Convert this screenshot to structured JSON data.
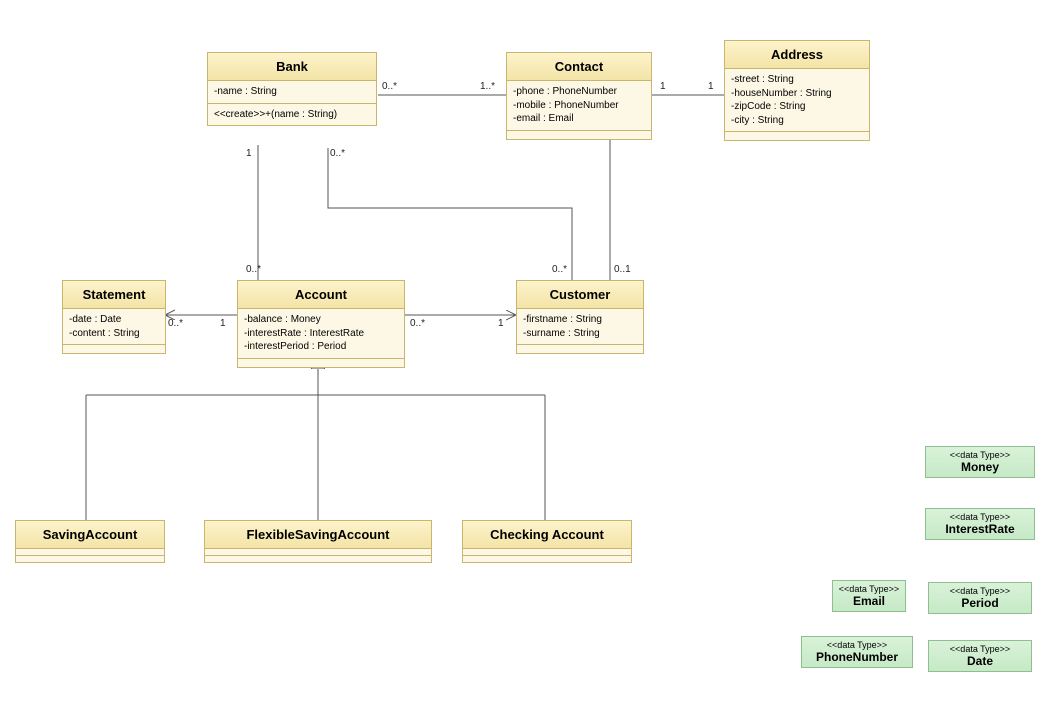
{
  "classes": {
    "bank": {
      "name": "Bank",
      "attrs": [
        "-name : String"
      ],
      "ops": [
        "<<create>>+(name : String)"
      ]
    },
    "contact": {
      "name": "Contact",
      "attrs": [
        "-phone : PhoneNumber",
        "-mobile : PhoneNumber",
        "-email : Email"
      ],
      "ops": []
    },
    "address": {
      "name": "Address",
      "attrs": [
        "-street : String",
        "-houseNumber : String",
        "-zipCode : String",
        "-city : String"
      ],
      "ops": []
    },
    "statement": {
      "name": "Statement",
      "attrs": [
        "-date : Date",
        "-content : String"
      ],
      "ops": []
    },
    "account": {
      "name": "Account",
      "attrs": [
        "-balance : Money",
        "-interestRate : InterestRate",
        "-interestPeriod : Period"
      ],
      "ops": []
    },
    "customer": {
      "name": "Customer",
      "attrs": [
        "-firstname : String",
        "-surname : String"
      ],
      "ops": []
    },
    "saving": {
      "name": "SavingAccount",
      "attrs": [],
      "ops": []
    },
    "flexible": {
      "name": "FlexibleSavingAccount",
      "attrs": [],
      "ops": []
    },
    "checking": {
      "name": "Checking Account",
      "attrs": [],
      "ops": []
    }
  },
  "datatypes": {
    "money": {
      "stereo": "<<data Type>>",
      "name": "Money"
    },
    "interestrate": {
      "stereo": "<<data Type>>",
      "name": "InterestRate"
    },
    "period": {
      "stereo": "<<data Type>>",
      "name": "Period"
    },
    "email": {
      "stereo": "<<data Type>>",
      "name": "Email"
    },
    "phonenumber": {
      "stereo": "<<data Type>>",
      "name": "PhoneNumber"
    },
    "date": {
      "stereo": "<<data Type>>",
      "name": "Date"
    }
  },
  "associations": {
    "bank_contact": {
      "m1": "0..*",
      "m2": "1..*"
    },
    "contact_address": {
      "m1": "1",
      "m2": "1"
    },
    "bank_account": {
      "m1": "1",
      "m2": "0..*"
    },
    "bank_customer": {
      "m1": "0..*",
      "m2": "0..*"
    },
    "contact_customer": {
      "m1": "",
      "m2": "0..1"
    },
    "account_customer": {
      "m1": "0..*",
      "m2": "1"
    },
    "account_statement": {
      "m1": "1",
      "m2": "0..*"
    }
  },
  "chart_data": {
    "type": "table",
    "diagram_type": "UML Class Diagram",
    "classes": [
      {
        "name": "Bank",
        "attributes": [
          "-name : String"
        ],
        "operations": [
          "<<create>>+(name : String)"
        ]
      },
      {
        "name": "Contact",
        "attributes": [
          "-phone : PhoneNumber",
          "-mobile : PhoneNumber",
          "-email : Email"
        ]
      },
      {
        "name": "Address",
        "attributes": [
          "-street : String",
          "-houseNumber : String",
          "-zipCode : String",
          "-city : String"
        ]
      },
      {
        "name": "Statement",
        "attributes": [
          "-date : Date",
          "-content : String"
        ]
      },
      {
        "name": "Account",
        "attributes": [
          "-balance : Money",
          "-interestRate : InterestRate",
          "-interestPeriod : Period"
        ]
      },
      {
        "name": "Customer",
        "attributes": [
          "-firstname : String",
          "-surname : String"
        ]
      },
      {
        "name": "SavingAccount"
      },
      {
        "name": "FlexibleSavingAccount"
      },
      {
        "name": "Checking Account"
      }
    ],
    "associations": [
      {
        "from": "Bank",
        "to": "Contact",
        "from_mult": "0..*",
        "to_mult": "1..*"
      },
      {
        "from": "Contact",
        "to": "Address",
        "from_mult": "1",
        "to_mult": "1"
      },
      {
        "from": "Bank",
        "to": "Account",
        "from_mult": "1",
        "to_mult": "0..*"
      },
      {
        "from": "Bank",
        "to": "Customer",
        "from_mult": "0..*",
        "to_mult": "0..*"
      },
      {
        "from": "Contact",
        "to": "Customer",
        "to_mult": "0..1"
      },
      {
        "from": "Account",
        "to": "Customer",
        "from_mult": "0..*",
        "to_mult": "1",
        "directed": true
      },
      {
        "from": "Account",
        "to": "Statement",
        "from_mult": "1",
        "to_mult": "0..*",
        "directed": true
      }
    ],
    "generalizations": [
      {
        "parent": "Account",
        "child": "SavingAccount"
      },
      {
        "parent": "Account",
        "child": "FlexibleSavingAccount"
      },
      {
        "parent": "Account",
        "child": "Checking Account"
      }
    ],
    "datatypes": [
      "Money",
      "InterestRate",
      "Period",
      "Email",
      "PhoneNumber",
      "Date"
    ]
  }
}
